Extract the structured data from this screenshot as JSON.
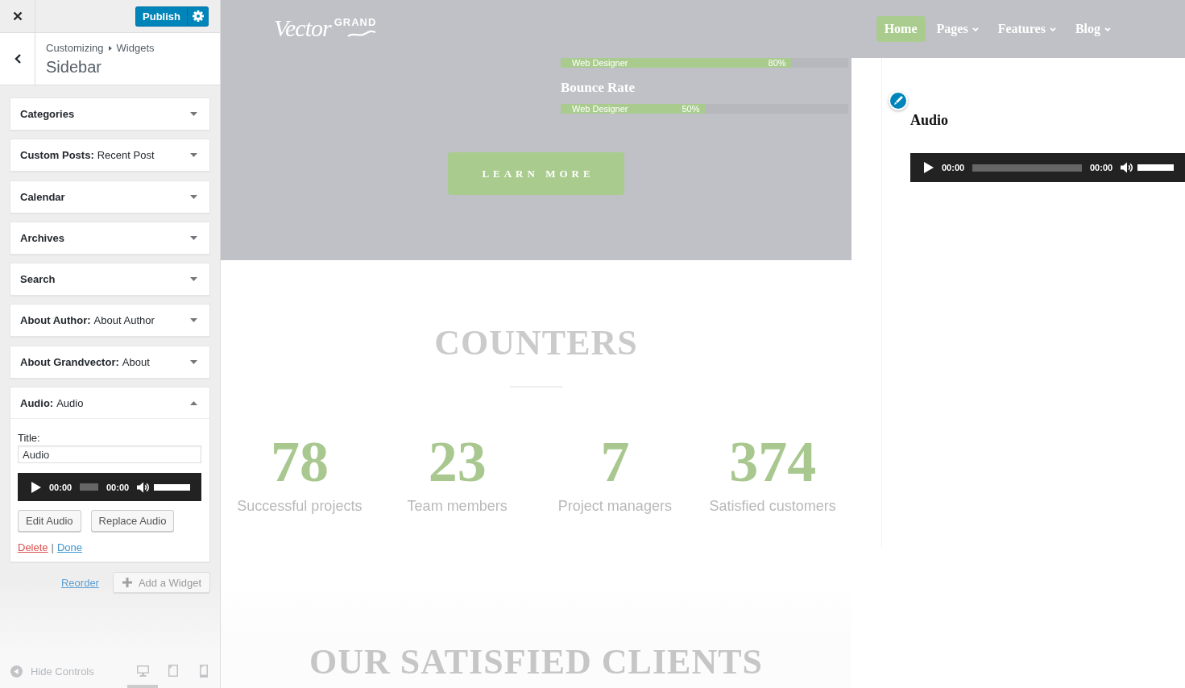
{
  "top_bar": {
    "publish_button": "Publish"
  },
  "section": {
    "breadcrumb": [
      "Customizing",
      "Widgets"
    ],
    "title": "Sidebar"
  },
  "widgets": [
    {
      "name": "Categories",
      "expanded": false
    },
    {
      "name": "Custom Posts:",
      "instance": "Recent Post",
      "expanded": false
    },
    {
      "name": "Calendar",
      "expanded": false
    },
    {
      "name": "Archives",
      "expanded": false
    },
    {
      "name": "Search",
      "expanded": false
    },
    {
      "name": "About Author:",
      "instance": "About Author",
      "expanded": false
    },
    {
      "name": "About Grandvector:",
      "instance": "About",
      "expanded": false
    },
    {
      "name": "Audio:",
      "instance": "Audio",
      "expanded": true,
      "form": {
        "title_label": "Title:",
        "title_value": "Audio",
        "player": {
          "current_time": "00:00",
          "duration": "00:00",
          "volume": {
            "level": 1
          }
        },
        "buttons": [
          "Edit Audio",
          "Replace Audio"
        ],
        "delete_link": "Delete",
        "separator": "|",
        "done_link": "Done"
      }
    }
  ],
  "widget_actions": {
    "reorder_link": "Reorder",
    "add_button": "Add a Widget"
  },
  "footer": {
    "hide_controls": "Hide Controls",
    "devices": [
      {
        "kind": "desktop",
        "selected": true
      },
      {
        "kind": "tablet",
        "selected": false
      },
      {
        "kind": "mobile",
        "selected": false
      }
    ]
  },
  "preview": {
    "logo": {
      "script": "Vector",
      "caps": "GRAND"
    },
    "nav": [
      {
        "label": "Home",
        "selected": true,
        "dropdown": false
      },
      {
        "label": "Pages",
        "selected": false,
        "dropdown": true
      },
      {
        "label": "Features",
        "selected": false,
        "dropdown": true
      },
      {
        "label": "Blog",
        "selected": false,
        "dropdown": true
      }
    ],
    "skills": [
      {
        "label": "Web Designer",
        "reading": "80%",
        "level": 0.8
      },
      {
        "heading": "Bounce Rate",
        "label": "Web Designer",
        "reading": "50%",
        "level": 0.5
      }
    ],
    "cta_button": "LEARN MORE",
    "counters": {
      "heading": "COUNTERS",
      "items": [
        {
          "value": "78",
          "label": "Successful projects"
        },
        {
          "value": "23",
          "label": "Team members"
        },
        {
          "value": "7",
          "label": "Project managers"
        },
        {
          "value": "374",
          "label": "Satisfied customers"
        }
      ]
    },
    "clients_heading": "OUR SATISFIED CLIENTS",
    "sidebar_widget": {
      "title": "Audio",
      "player": {
        "current_time": "00:00",
        "duration": "00:00",
        "volume": {
          "level": 1
        }
      }
    }
  }
}
